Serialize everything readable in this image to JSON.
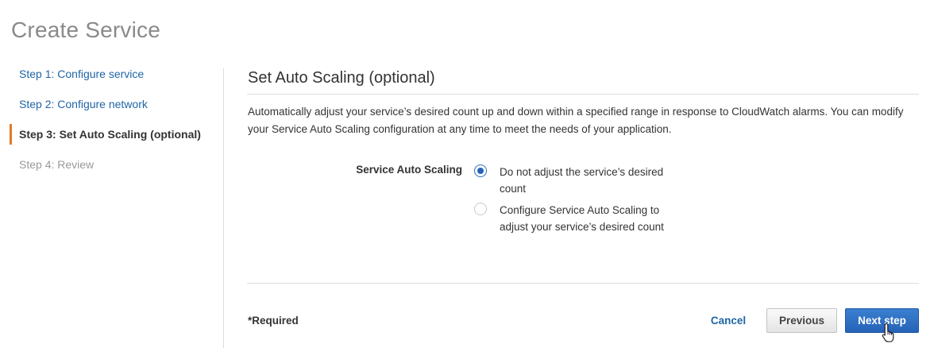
{
  "page": {
    "title": "Create Service"
  },
  "steps": [
    {
      "label": "Step 1: Configure service",
      "state": "link"
    },
    {
      "label": "Step 2: Configure network",
      "state": "link"
    },
    {
      "label": "Step 3: Set Auto Scaling (optional)",
      "state": "active"
    },
    {
      "label": "Step 4: Review",
      "state": "disabled"
    }
  ],
  "section": {
    "title": "Set Auto Scaling (optional)",
    "description": "Automatically adjust your service’s desired count up and down within a specified range in response to CloudWatch alarms. You can modify your Service Auto Scaling configuration at any time to meet the needs of your application."
  },
  "auto_scaling": {
    "label": "Service Auto Scaling",
    "options": [
      {
        "label": "Do not adjust the service’s desired count",
        "selected": true
      },
      {
        "label": "Configure Service Auto Scaling to adjust your service’s desired count",
        "selected": false
      }
    ]
  },
  "footer": {
    "required_note": "*Required",
    "cancel_label": "Cancel",
    "previous_label": "Previous",
    "next_label": "Next step"
  },
  "colors": {
    "link": "#1f65a6",
    "active_step_marker": "#e07b24",
    "primary_button": "#2663b8"
  },
  "icons": {
    "cursor": "hand-pointer-icon"
  }
}
